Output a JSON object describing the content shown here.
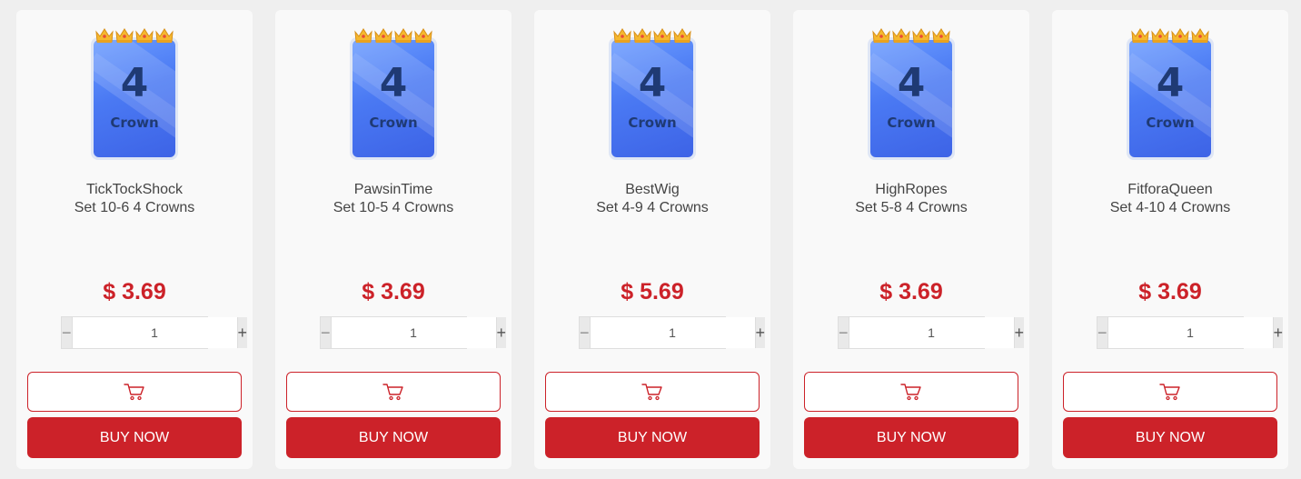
{
  "products": [
    {
      "card_number": "4",
      "card_word": "Crown",
      "name": "TickTockShock",
      "subtitle": "Set 10-6 4 Crowns",
      "price": "$ 3.69",
      "quantity": "1",
      "minus_label": "−",
      "plus_label": "+",
      "buy_label": "BUY NOW",
      "crowns": 4
    },
    {
      "card_number": "4",
      "card_word": "Crown",
      "name": "PawsinTime",
      "subtitle": "Set 10-5 4 Crowns",
      "price": "$ 3.69",
      "quantity": "1",
      "minus_label": "−",
      "plus_label": "+",
      "buy_label": "BUY NOW",
      "crowns": 4
    },
    {
      "card_number": "4",
      "card_word": "Crown",
      "name": "BestWig",
      "subtitle": "Set 4-9 4 Crowns",
      "price": "$ 5.69",
      "quantity": "1",
      "minus_label": "−",
      "plus_label": "+",
      "buy_label": "BUY NOW",
      "crowns": 4
    },
    {
      "card_number": "4",
      "card_word": "Crown",
      "name": "HighRopes",
      "subtitle": "Set 5-8 4 Crowns",
      "price": "$ 3.69",
      "quantity": "1",
      "minus_label": "−",
      "plus_label": "+",
      "buy_label": "BUY NOW",
      "crowns": 4
    },
    {
      "card_number": "4",
      "card_word": "Crown",
      "name": "FitforaQueen",
      "subtitle": "Set 4-10 4 Crowns",
      "price": "$ 3.69",
      "quantity": "1",
      "minus_label": "−",
      "plus_label": "+",
      "buy_label": "BUY NOW",
      "crowns": 4
    }
  ],
  "icons": {
    "crown": "crown-icon",
    "cart": "cart-icon"
  },
  "colors": {
    "accent": "#cc2229",
    "page_background": "#efefef",
    "card_background": "#f9f9f9",
    "card_art_blue": "#4a79f3",
    "card_art_text": "#1f3a74",
    "crown_gold": "#f5b82e"
  }
}
